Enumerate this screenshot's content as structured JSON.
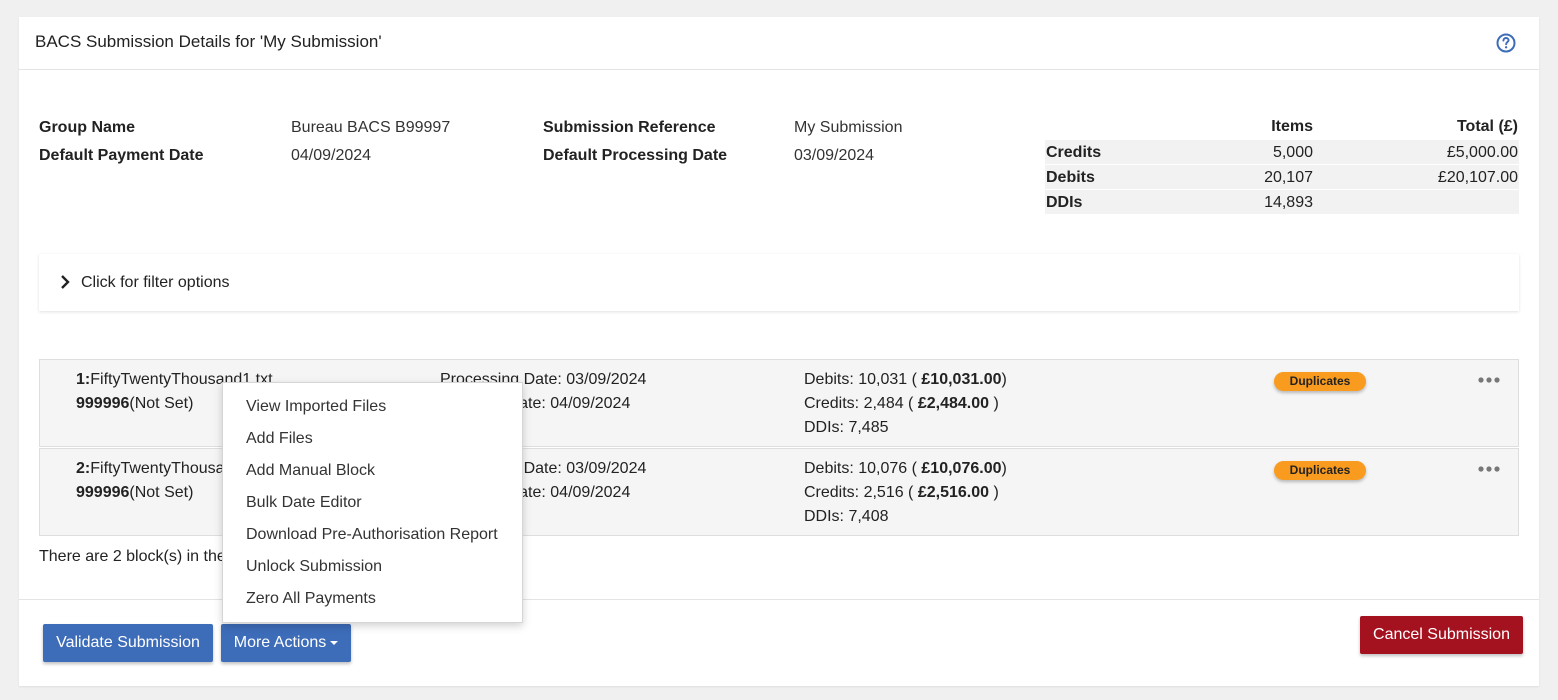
{
  "header": {
    "title": "BACS Submission Details for 'My Submission'",
    "help_icon": "question-circle-icon"
  },
  "details": {
    "group_name_label": "Group Name",
    "group_name_value": "Bureau BACS B99997",
    "default_payment_date_label": "Default Payment Date",
    "default_payment_date_value": "04/09/2024",
    "submission_reference_label": "Submission Reference",
    "submission_reference_value": "My Submission",
    "default_processing_date_label": "Default Processing Date",
    "default_processing_date_value": "03/09/2024"
  },
  "totals": {
    "headers": {
      "items": "Items",
      "total": "Total (£)"
    },
    "rows": [
      {
        "label": "Credits",
        "items": "5,000",
        "total": "£5,000.00"
      },
      {
        "label": "Debits",
        "items": "20,107",
        "total": "£20,107.00"
      },
      {
        "label": "DDIs",
        "items": "14,893",
        "total": ""
      }
    ]
  },
  "filter": {
    "label": "Click for filter options",
    "icon": "chevron-right-icon"
  },
  "blocks": [
    {
      "index": "1:",
      "filename": "FiftyTwentyThousand1.txt",
      "account": "999996",
      "account_note": "(Not Set)",
      "processing_date": "Processing Date: 03/09/2024",
      "payment_date": "Payment Date: 04/09/2024",
      "debits_prefix": "Debits: 10,031 ( ",
      "debits_amount": "£10,031.00",
      "debits_suffix": ")",
      "credits_prefix": "Credits: 2,484 ( ",
      "credits_amount": "£2,484.00",
      "credits_suffix": " )",
      "ddis": "DDIs: 7,485",
      "badge": "Duplicates"
    },
    {
      "index": "2:",
      "filename": "FiftyTwentyThousand2.txt",
      "account": "999996",
      "account_note": "(Not Set)",
      "processing_date": "Processing Date: 03/09/2024",
      "payment_date": "Payment Date: 04/09/2024",
      "debits_prefix": "Debits: 10,076 ( ",
      "debits_amount": "£10,076.00",
      "debits_suffix": ")",
      "credits_prefix": "Credits: 2,516 ( ",
      "credits_amount": "£2,516.00",
      "credits_suffix": " )",
      "ddis": "DDIs: 7,408",
      "badge": "Duplicates"
    }
  ],
  "footnote": "There are 2 block(s) in the submission.",
  "menu": {
    "items": [
      "View Imported Files",
      "Add Files",
      "Add Manual Block",
      "Bulk Date Editor",
      "Download Pre-Authorisation Report",
      "Unlock Submission",
      "Zero All Payments"
    ]
  },
  "buttons": {
    "validate": "Validate Submission",
    "more_actions": "More Actions",
    "cancel": "Cancel Submission"
  },
  "colors": {
    "primary": "#3d6cb8",
    "danger": "#a5121f",
    "badge": "#f89b1e"
  }
}
